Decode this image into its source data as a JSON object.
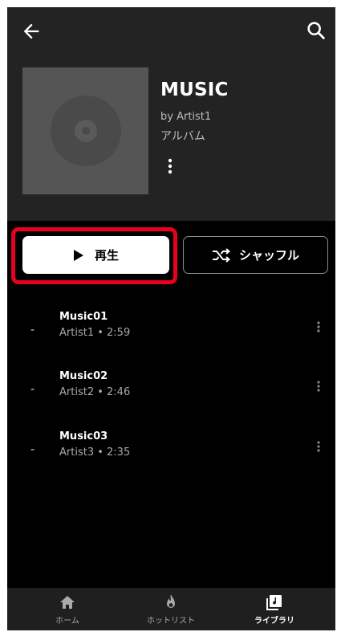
{
  "header": {
    "title": "MUSIC",
    "artist": "by Artist1",
    "type": "アルバム"
  },
  "actions": {
    "play_label": "再生",
    "shuffle_label": "シャッフル"
  },
  "tracks": [
    {
      "index": "-",
      "title": "Music01",
      "sub": "Artist1 • 2:59"
    },
    {
      "index": "-",
      "title": "Music02",
      "sub": "Artist2 • 2:46"
    },
    {
      "index": "-",
      "title": "Music03",
      "sub": "Artist3 • 2:35"
    }
  ],
  "nav": {
    "home": "ホーム",
    "hotlist": "ホットリスト",
    "library": "ライブラリ"
  },
  "icons": {
    "back": "arrow-left-icon",
    "search": "search-icon",
    "more": "more-vert-icon",
    "play": "play-icon",
    "shuffle": "shuffle-icon",
    "home": "home-icon",
    "hotlist": "flame-icon",
    "library": "library-music-icon"
  },
  "colors": {
    "header_bg": "#232323",
    "screen_bg": "#000000",
    "highlight": "#e8001d",
    "nav_bg": "#1f1f1f"
  }
}
